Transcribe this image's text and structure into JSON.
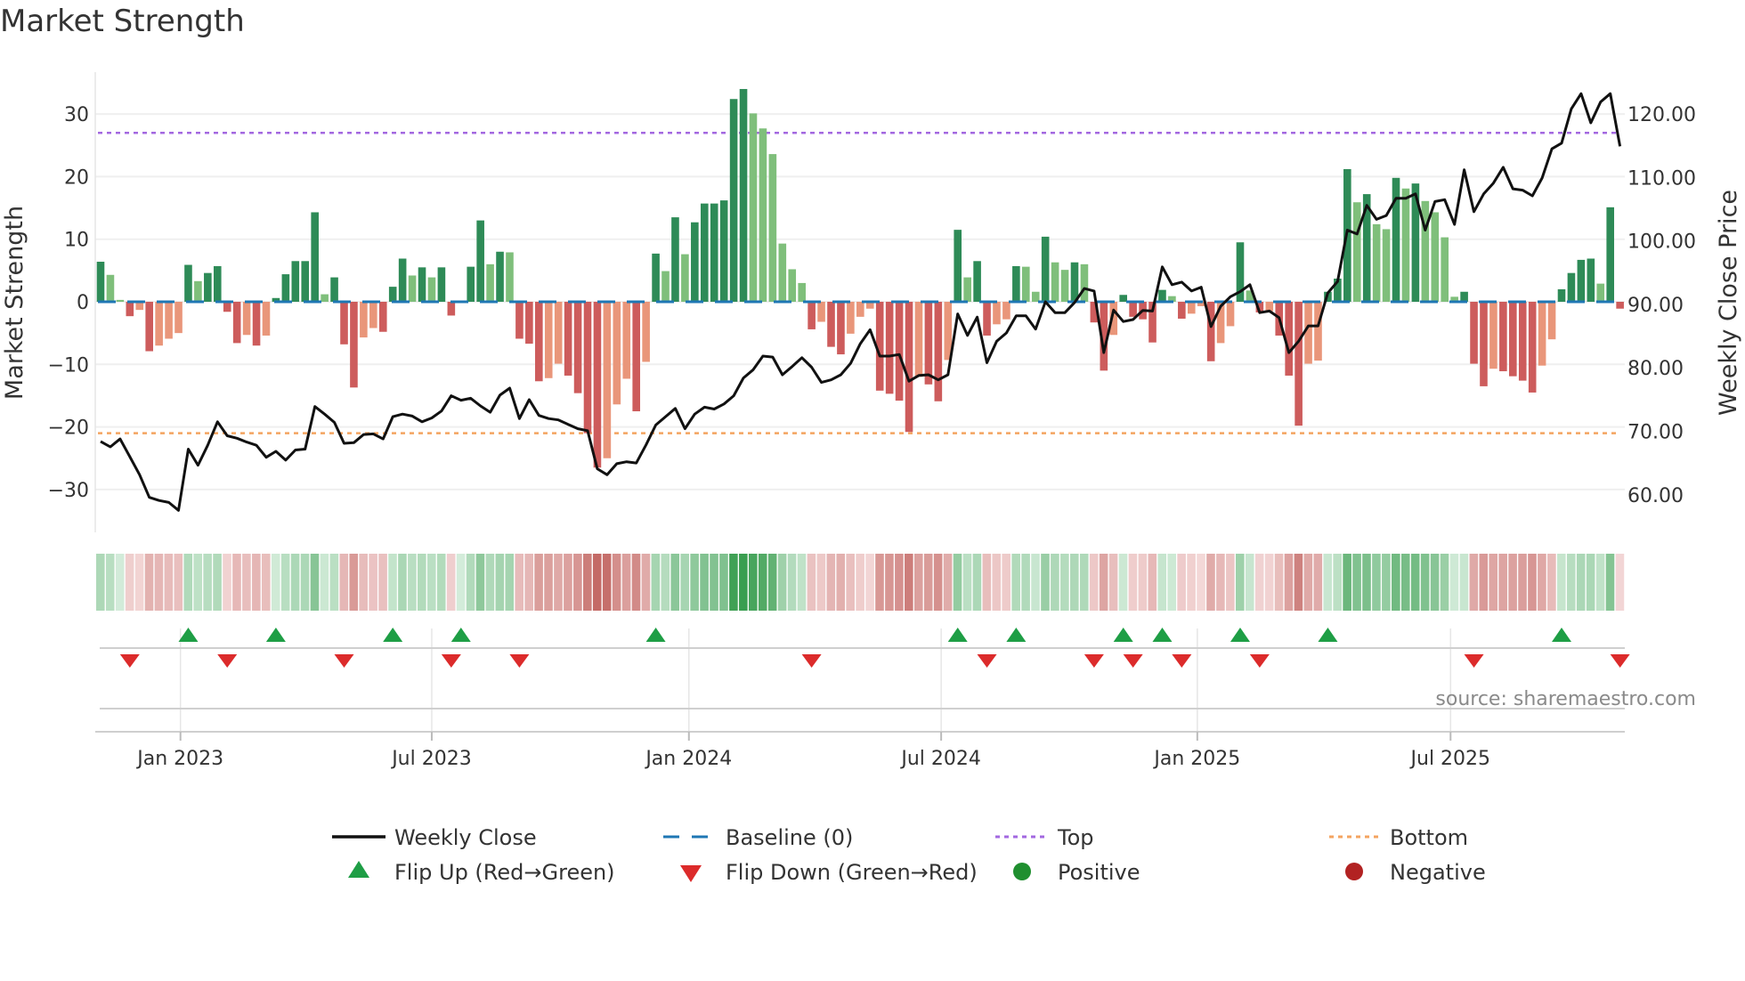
{
  "title": "Market Strength",
  "source": "source: sharemaestro.com",
  "colors": {
    "up_strong": "#2e8b57",
    "up_weak": "#7fbf7b",
    "down_strong": "#cd5c5c",
    "down_weak": "#e9967a",
    "price": "#111111",
    "baseline": "#1f77b4",
    "top": "#a368e0",
    "bottom": "#f4a460",
    "flip_up": "#1e9e45",
    "flip_down": "#dc2b2b",
    "positive": "#1f8f2f",
    "negative": "#b22222"
  },
  "chart_data": {
    "type": "bar",
    "title": "Market Strength",
    "ylabel": "Market Strength",
    "y2label": "Weekly Close Price",
    "ylim": [
      -37,
      37
    ],
    "y2lim": [
      54.8,
      126.6
    ],
    "yticks": [
      {
        "v": 30,
        "label": "30"
      },
      {
        "v": 20,
        "label": "20"
      },
      {
        "v": 10,
        "label": "10"
      },
      {
        "v": 0,
        "label": "0"
      },
      {
        "v": -10,
        "label": "−10"
      },
      {
        "v": -20,
        "label": "−20"
      },
      {
        "v": -30,
        "label": "−30"
      }
    ],
    "y2ticks": [
      {
        "v": 120,
        "label": "120.00"
      },
      {
        "v": 110,
        "label": "110.00"
      },
      {
        "v": 100,
        "label": "100.00"
      },
      {
        "v": 90,
        "label": "90.00"
      },
      {
        "v": 80,
        "label": "80.00"
      },
      {
        "v": 70,
        "label": "70.00"
      },
      {
        "v": 60,
        "label": "60.00"
      }
    ],
    "xticks": [
      {
        "week": 8.2,
        "label": "Jan 2023"
      },
      {
        "week": 34.0,
        "label": "Jul 2023"
      },
      {
        "week": 60.4,
        "label": "Jan 2024"
      },
      {
        "week": 86.3,
        "label": "Jul 2024"
      },
      {
        "week": 112.6,
        "label": "Jan 2025"
      },
      {
        "week": 138.6,
        "label": "Jul 2025"
      }
    ],
    "top_level": 27,
    "bottom_level": -21,
    "baseline": 0,
    "grid": true,
    "legend_position": "bottom-center",
    "strength": [
      6.4,
      4.3,
      0.3,
      -2.3,
      -1.3,
      -7.9,
      -7.0,
      -5.9,
      -5.0,
      5.9,
      3.3,
      4.6,
      5.7,
      -1.6,
      -6.6,
      -5.3,
      -7.0,
      -5.4,
      0.6,
      4.4,
      6.5,
      6.5,
      14.3,
      1.2,
      3.9,
      -6.8,
      -13.7,
      -5.7,
      -4.2,
      -4.8,
      2.4,
      6.9,
      4.2,
      5.5,
      3.9,
      5.5,
      -2.2,
      0.2,
      5.6,
      13.0,
      6.0,
      8.0,
      7.9,
      -5.9,
      -6.7,
      -12.7,
      -12.2,
      -9.9,
      -11.8,
      -14.6,
      -21.0,
      -26.5,
      -25.0,
      -16.4,
      -12.3,
      -17.5,
      -9.6,
      7.7,
      4.9,
      13.5,
      7.6,
      12.7,
      15.7,
      15.7,
      16.2,
      32.4,
      34.0,
      30.1,
      27.7,
      23.6,
      9.3,
      5.2,
      3.0,
      -4.4,
      -3.2,
      -7.2,
      -8.4,
      -5.1,
      -2.4,
      -1.1,
      -14.2,
      -14.7,
      -15.8,
      -20.8,
      -12.0,
      -13.2,
      -15.9,
      -9.3,
      11.5,
      3.9,
      6.5,
      -5.4,
      -3.6,
      -2.8,
      5.7,
      5.6,
      1.6,
      10.4,
      6.3,
      5.1,
      6.3,
      6.0,
      -3.3,
      -11.0,
      -5.3,
      1.1,
      -2.4,
      -2.8,
      -6.5,
      1.9,
      0.9,
      -2.7,
      -1.9,
      -0.7,
      -9.5,
      -6.6,
      -3.9,
      9.5,
      1.8,
      -1.7,
      -1.5,
      -5.4,
      -11.8,
      -19.8,
      -9.9,
      -9.4,
      1.6,
      3.7,
      21.2,
      15.9,
      17.2,
      12.4,
      11.6,
      19.8,
      18.1,
      18.9,
      16.1,
      14.3,
      10.3,
      0.8,
      1.6,
      -9.9,
      -13.5,
      -10.7,
      -11.1,
      -11.9,
      -12.6,
      -14.5,
      -10.2,
      -6.0,
      2.0,
      4.6,
      6.7,
      6.9,
      2.9,
      15.1,
      -1.1
    ],
    "weekly_close": [
      68.4,
      67.55,
      68.8,
      66.0,
      63.15,
      59.6,
      59.1,
      58.8,
      57.55,
      67.2,
      64.65,
      67.8,
      71.5,
      69.3,
      68.9,
      68.3,
      67.8,
      65.9,
      66.85,
      65.45,
      67.05,
      67.2,
      73.9,
      72.7,
      71.4,
      68.1,
      68.2,
      69.5,
      69.6,
      68.8,
      72.3,
      72.7,
      72.4,
      71.5,
      72.1,
      73.2,
      75.6,
      74.9,
      75.2,
      74.0,
      73.0,
      75.7,
      76.8,
      72.0,
      75.0,
      72.5,
      72.0,
      71.8,
      71.1,
      70.4,
      70.1,
      64.1,
      63.15,
      64.9,
      65.2,
      65.0,
      67.85,
      71.0,
      72.3,
      73.6,
      70.4,
      72.7,
      73.8,
      73.5,
      74.3,
      75.6,
      78.4,
      79.7,
      81.85,
      81.7,
      78.9,
      80.2,
      81.6,
      80.1,
      77.7,
      78.1,
      78.9,
      80.7,
      83.8,
      86.0,
      81.85,
      81.85,
      82.1,
      77.9,
      78.8,
      78.9,
      78.1,
      78.9,
      88.5,
      85.1,
      88.0,
      80.8,
      84.2,
      85.5,
      88.2,
      88.2,
      86.1,
      90.4,
      88.7,
      88.7,
      90.3,
      92.5,
      92.1,
      82.4,
      89.1,
      87.3,
      87.6,
      89.05,
      88.95,
      95.9,
      93.1,
      93.5,
      92.1,
      92.7,
      86.5,
      89.7,
      91.2,
      92.0,
      93.1,
      88.7,
      88.95,
      87.9,
      82.4,
      84.2,
      86.6,
      86.6,
      91.8,
      93.6,
      101.7,
      101.1,
      105.6,
      103.4,
      104.0,
      106.7,
      106.7,
      107.4,
      101.7,
      106.2,
      106.5,
      102.6,
      111.2,
      104.6,
      107.4,
      109.1,
      111.6,
      108.2,
      108.0,
      107.1,
      109.9,
      114.5,
      115.4,
      120.8,
      123.2,
      118.6,
      121.9,
      123.2,
      114.9
    ],
    "flip_up_weeks": [
      9,
      18,
      30,
      37,
      57,
      88,
      94,
      105,
      109,
      117,
      126,
      150
    ],
    "flip_down_weeks": [
      3,
      13,
      25,
      36,
      43,
      73,
      91,
      102,
      106,
      111,
      119,
      141,
      156
    ]
  },
  "legend": {
    "weekly_close": "Weekly Close",
    "baseline": "Baseline (0)",
    "top": "Top",
    "bottom": "Bottom",
    "flip_up": "Flip Up (Red→Green)",
    "flip_down": "Flip Down (Green→Red)",
    "positive": "Positive",
    "negative": "Negative"
  }
}
